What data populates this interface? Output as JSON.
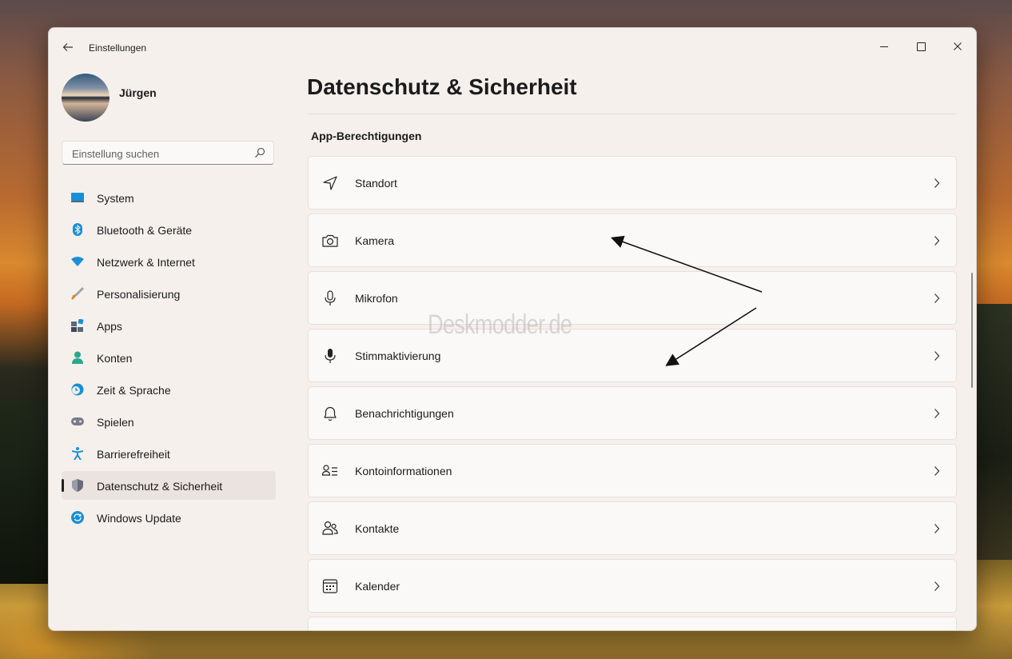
{
  "window": {
    "title": "Einstellungen"
  },
  "user": {
    "name": "Jürgen"
  },
  "search": {
    "placeholder": "Einstellung suchen"
  },
  "sidebar": {
    "items": [
      {
        "label": "System",
        "icon": "system-icon",
        "color": "#1a8fd6"
      },
      {
        "label": "Bluetooth & Geräte",
        "icon": "bluetooth-icon",
        "color": "#1a8fd6"
      },
      {
        "label": "Netzwerk & Internet",
        "icon": "network-icon",
        "color": "#1a8fd6"
      },
      {
        "label": "Personalisierung",
        "icon": "brush-icon",
        "color": "#d48a2a"
      },
      {
        "label": "Apps",
        "icon": "apps-icon",
        "color": "#5a6a7a"
      },
      {
        "label": "Konten",
        "icon": "accounts-icon",
        "color": "#2aa88a"
      },
      {
        "label": "Zeit & Sprache",
        "icon": "time-language-icon",
        "color": "#1a8fd6"
      },
      {
        "label": "Spielen",
        "icon": "gaming-icon",
        "color": "#7a7a8a"
      },
      {
        "label": "Barrierefreiheit",
        "icon": "accessibility-icon",
        "color": "#1a8fd6"
      },
      {
        "label": "Datenschutz & Sicherheit",
        "icon": "shield-icon",
        "color": "#6a6a78",
        "active": true
      },
      {
        "label": "Windows Update",
        "icon": "update-icon",
        "color": "#1a8fd6"
      }
    ]
  },
  "main": {
    "title": "Datenschutz & Sicherheit",
    "section": "App-Berechtigungen",
    "items": [
      {
        "label": "Standort",
        "icon": "location-icon"
      },
      {
        "label": "Kamera",
        "icon": "camera-icon"
      },
      {
        "label": "Mikrofon",
        "icon": "microphone-icon"
      },
      {
        "label": "Stimmaktivierung",
        "icon": "voice-activation-icon"
      },
      {
        "label": "Benachrichtigungen",
        "icon": "bell-icon"
      },
      {
        "label": "Kontoinformationen",
        "icon": "account-info-icon"
      },
      {
        "label": "Kontakte",
        "icon": "contacts-icon"
      },
      {
        "label": "Kalender",
        "icon": "calendar-icon"
      }
    ]
  },
  "watermark": "Deskmodder.de"
}
